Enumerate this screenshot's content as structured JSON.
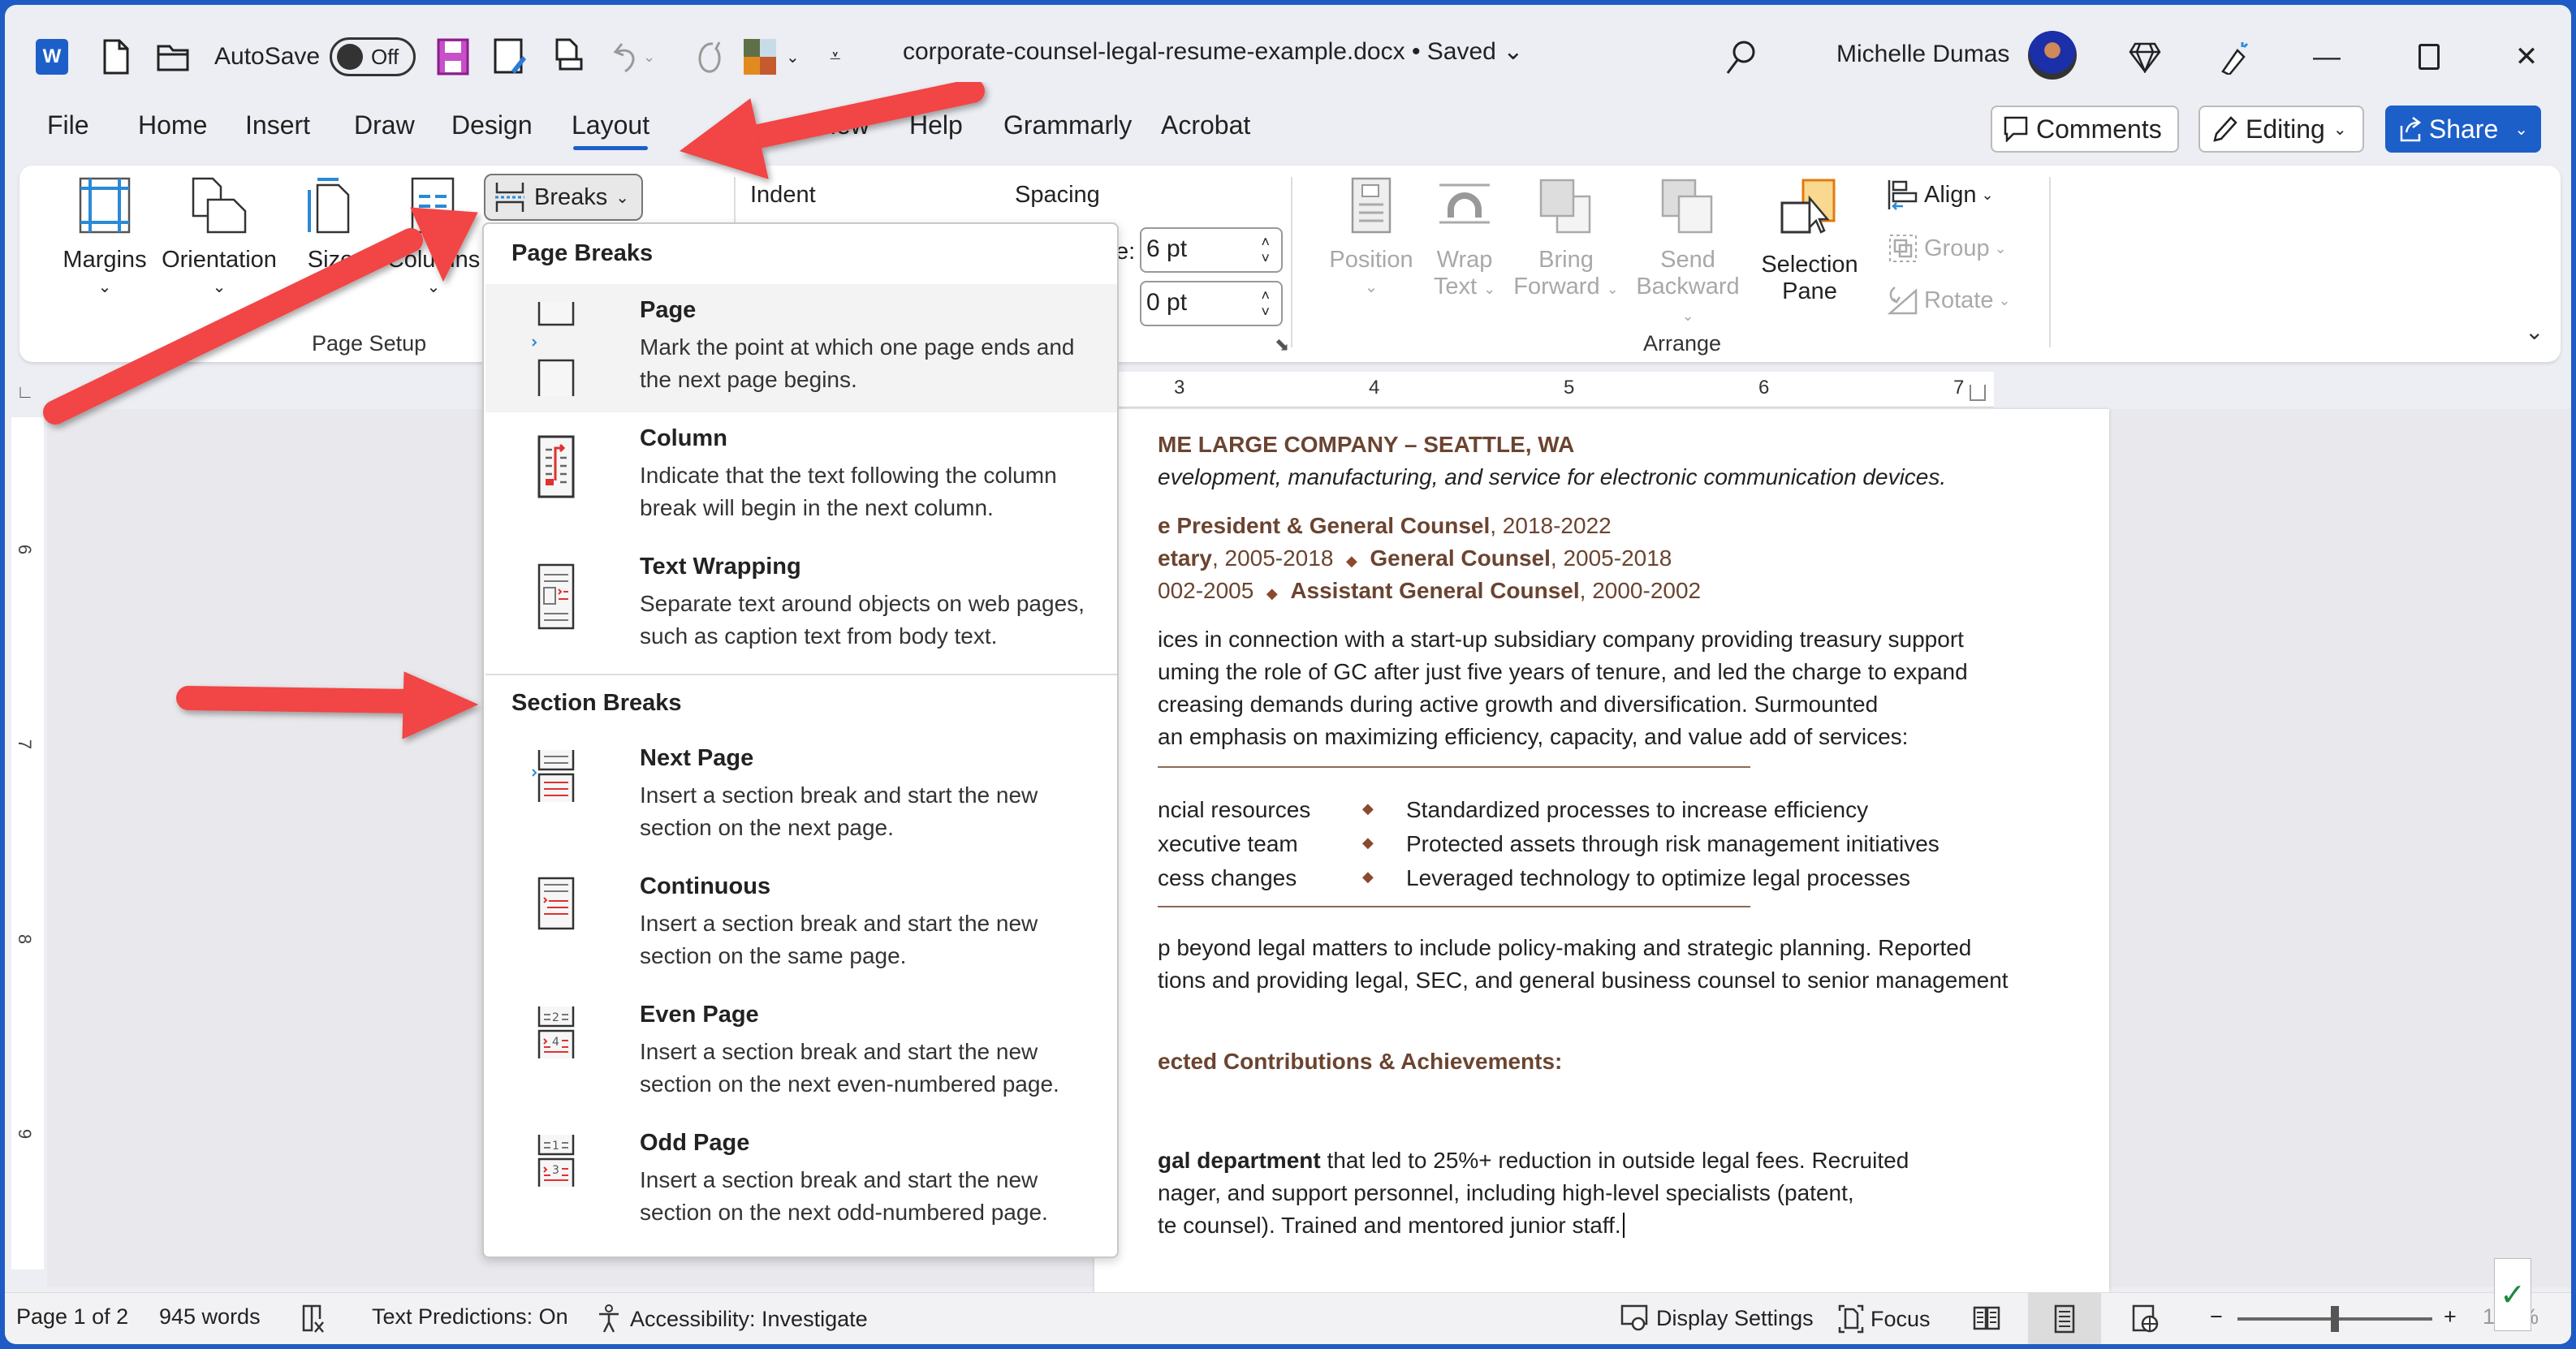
{
  "titlebar": {
    "autosave_label": "AutoSave",
    "autosave_state": "Off",
    "document_title": "corporate-counsel-legal-resume-example.docx • Saved",
    "user_name": "Michelle Dumas"
  },
  "tabs": [
    {
      "label": "File"
    },
    {
      "label": "Home"
    },
    {
      "label": "Insert"
    },
    {
      "label": "Draw"
    },
    {
      "label": "Design"
    },
    {
      "label": "Layout",
      "active": true
    },
    {
      "label": "View"
    },
    {
      "label": "Help"
    },
    {
      "label": "Grammarly"
    },
    {
      "label": "Acrobat"
    }
  ],
  "top_buttons": {
    "comments": "Comments",
    "editing": "Editing",
    "share": "Share"
  },
  "ribbon": {
    "page_setup": {
      "label": "Page Setup",
      "margins": "Margins",
      "orientation": "Orientation",
      "size": "Size",
      "columns": "Columns",
      "breaks": "Breaks"
    },
    "paragraph": {
      "indent_label": "Indent",
      "spacing_label": "Spacing",
      "spacing_before_prefix": "e:",
      "spacing_before": "6 pt",
      "spacing_after": "0 pt"
    },
    "arrange": {
      "label": "Arrange",
      "position": "Position",
      "wrap_text_1": "Wrap",
      "wrap_text_2": "Text",
      "bring_forward_1": "Bring",
      "bring_forward_2": "Forward",
      "send_backward_1": "Send",
      "send_backward_2": "Backward",
      "selection_pane_1": "Selection",
      "selection_pane_2": "Pane",
      "align": "Align",
      "group": "Group",
      "rotate": "Rotate"
    }
  },
  "ruler": {
    "horizontal": [
      "3",
      "4",
      "5",
      "6",
      "7"
    ],
    "vertical": [
      "6",
      "7",
      "8",
      "9"
    ]
  },
  "breaks_menu": {
    "page_breaks_heading": "Page Breaks",
    "section_breaks_heading": "Section Breaks",
    "page_breaks": [
      {
        "title": "Page",
        "desc": "Mark the point at which one page ends and the next page begins."
      },
      {
        "title": "Column",
        "desc": "Indicate that the text following the column break will begin in the next column."
      },
      {
        "title": "Text Wrapping",
        "desc": "Separate text around objects on web pages, such as caption text from body text."
      }
    ],
    "section_breaks": [
      {
        "title": "Next Page",
        "desc": "Insert a section break and start the new section on the next page."
      },
      {
        "title": "Continuous",
        "desc": "Insert a section break and start the new section on the same page."
      },
      {
        "title": "Even Page",
        "desc": "Insert a section break and start the new section on the next even-numbered page."
      },
      {
        "title": "Odd Page",
        "desc": "Insert a section break and start the new section on the next odd-numbered page."
      }
    ]
  },
  "document": {
    "company": "ME LARGE COMPANY – SEATTLE, WA",
    "company_desc": "evelopment, manufacturing, and service for electronic communication devices.",
    "role1_title": "e President & General Counsel",
    "role1_dates": ", 2018-2022",
    "role2a_tail": "etary",
    "role2a_dates": ", 2005-2018",
    "role2b_title": "General Counsel",
    "role2b_dates": ", 2005-2018",
    "role3a_dates": "002-2005",
    "role3b_title": "Assistant General Counsel",
    "role3b_dates": ", 2000-2002",
    "para1": [
      "ices in connection with a start-up subsidiary company providing treasury support",
      "uming the role of GC after just five years of tenure, and led the charge to expand",
      "creasing demands during active growth and diversification. Surmounted",
      " an emphasis on maximizing efficiency, capacity, and value add of services:"
    ],
    "bullets_left": [
      "ncial resources",
      "xecutive team",
      "cess changes"
    ],
    "bullets_right": [
      "Standardized processes to increase efficiency",
      "Protected assets through risk management initiatives",
      "Leveraged technology to optimize legal processes"
    ],
    "para2": [
      "p beyond legal matters to include policy-making and strategic planning. Reported",
      "tions and providing legal, SEC, and general business counsel to senior management"
    ],
    "achievements_heading": "ected Contributions & Achievements:",
    "ach_bold": "gal department",
    "ach_line1_rest": " that led to 25%+ reduction in outside legal fees. Recruited",
    "ach_line2": "nager, and support personnel, including high-level specialists (patent,",
    "ach_line3": "te counsel). Trained and mentored junior staff."
  },
  "status_bar": {
    "page": "Page 1 of 2",
    "words": "945 words",
    "text_predictions": "Text Predictions: On",
    "accessibility": "Accessibility: Investigate",
    "display_settings": "Display Settings",
    "focus": "Focus",
    "zoom": "100%",
    "zoom_level_fraction": 0.5
  },
  "colors": {
    "accent": "#1d5fc9",
    "arrow": "#f24444",
    "doc_brown": "#6b4430"
  }
}
